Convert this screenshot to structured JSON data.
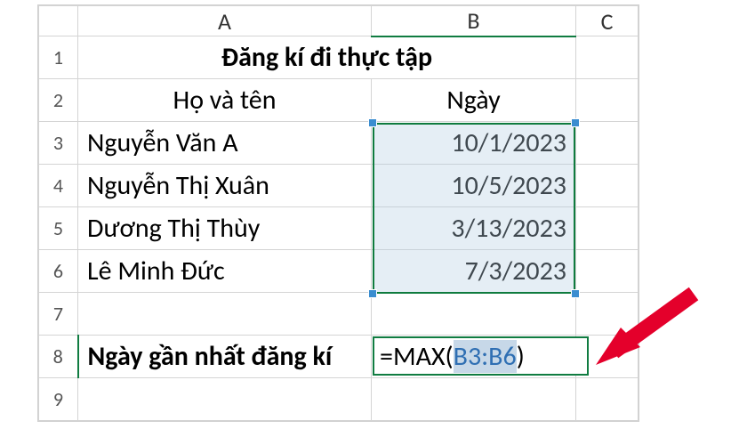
{
  "columns": {
    "rowhdr": "",
    "a": "A",
    "b": "B",
    "c": "C"
  },
  "rows": {
    "r1": "1",
    "r2": "2",
    "r3": "3",
    "r4": "4",
    "r5": "5",
    "r6": "6",
    "r7": "7",
    "r8": "8",
    "r9": "9"
  },
  "title": "Đăng kí đi thực tập",
  "headers": {
    "name": "Họ và tên",
    "date": "Ngày"
  },
  "data": [
    {
      "name": "Nguyễn Văn A",
      "date": "10/1/2023"
    },
    {
      "name": "Nguyễn Thị Xuân",
      "date": "10/5/2023"
    },
    {
      "name": "Dương Thị Thùy",
      "date": "3/13/2023"
    },
    {
      "name": "Lê Minh Đức",
      "date": "7/3/2023"
    }
  ],
  "label_recent": "Ngày gần nhất đăng kí",
  "formula": {
    "raw": "=MAX(B3:B6)",
    "prefix": "=MAX(",
    "ref": "B3:B6",
    "suffix": ")"
  },
  "colors": {
    "excel_green": "#107c41",
    "sel_blue": "#3a8dd0",
    "ref_blue": "#2f6fb3"
  }
}
